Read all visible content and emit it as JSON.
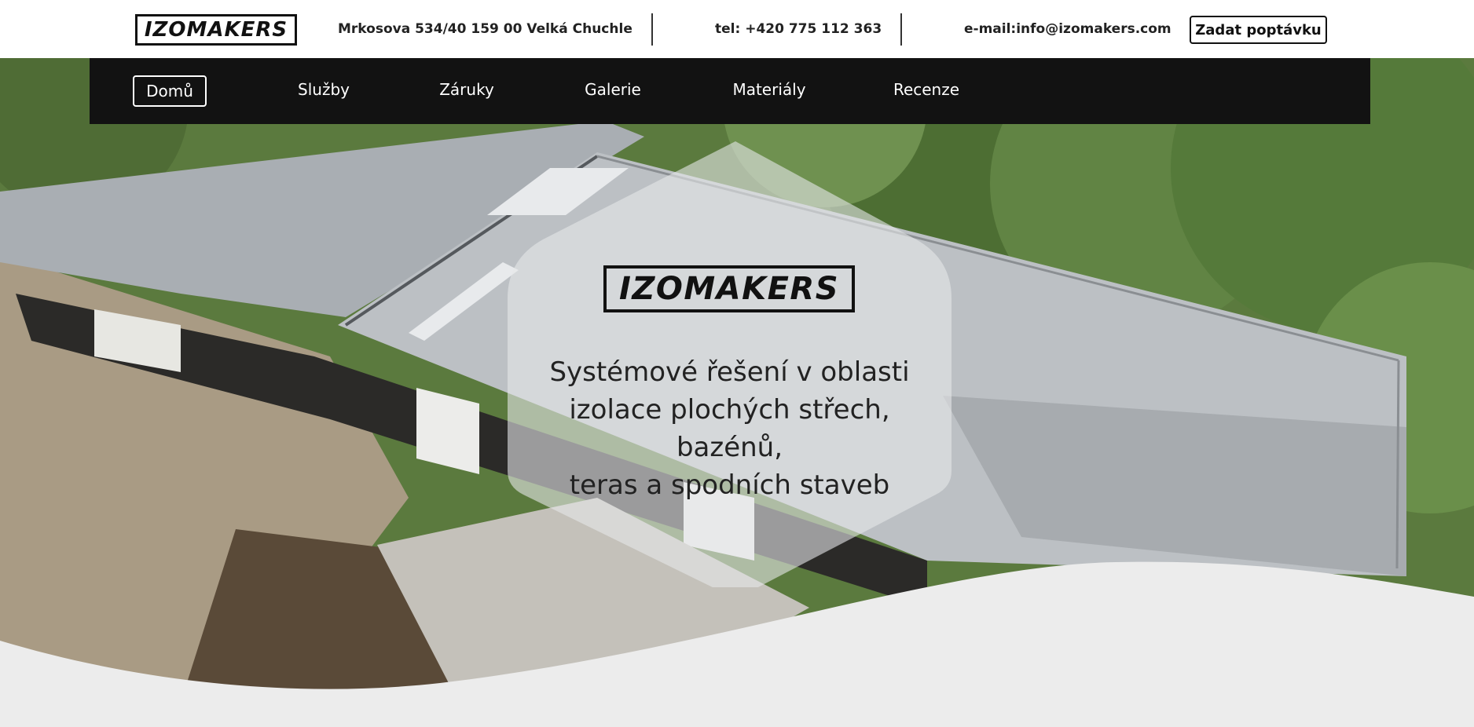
{
  "topbar": {
    "logo_text": "IZOMAKERS",
    "address": "Mrkosova 534/40 159 00 Velká Chuchle",
    "phone": "tel: +420 775 112 363",
    "email": "e-mail:info@izomakers.com",
    "quote_button": "Zadat poptávku"
  },
  "nav": {
    "items": [
      {
        "label": "Domů",
        "active": true
      },
      {
        "label": "Služby"
      },
      {
        "label": "Záruky"
      },
      {
        "label": "Galerie"
      },
      {
        "label": "Materiály"
      },
      {
        "label": "Recenze"
      }
    ]
  },
  "hero": {
    "logo_text": "IZOMAKERS",
    "tagline": "Systémové řešení v oblasti\nizolace plochých střech, bazénů,\nteras a spodních staveb"
  },
  "colors": {
    "nav_background": "#121212",
    "roof": "#b8bcc0",
    "wave": "#ececec"
  }
}
